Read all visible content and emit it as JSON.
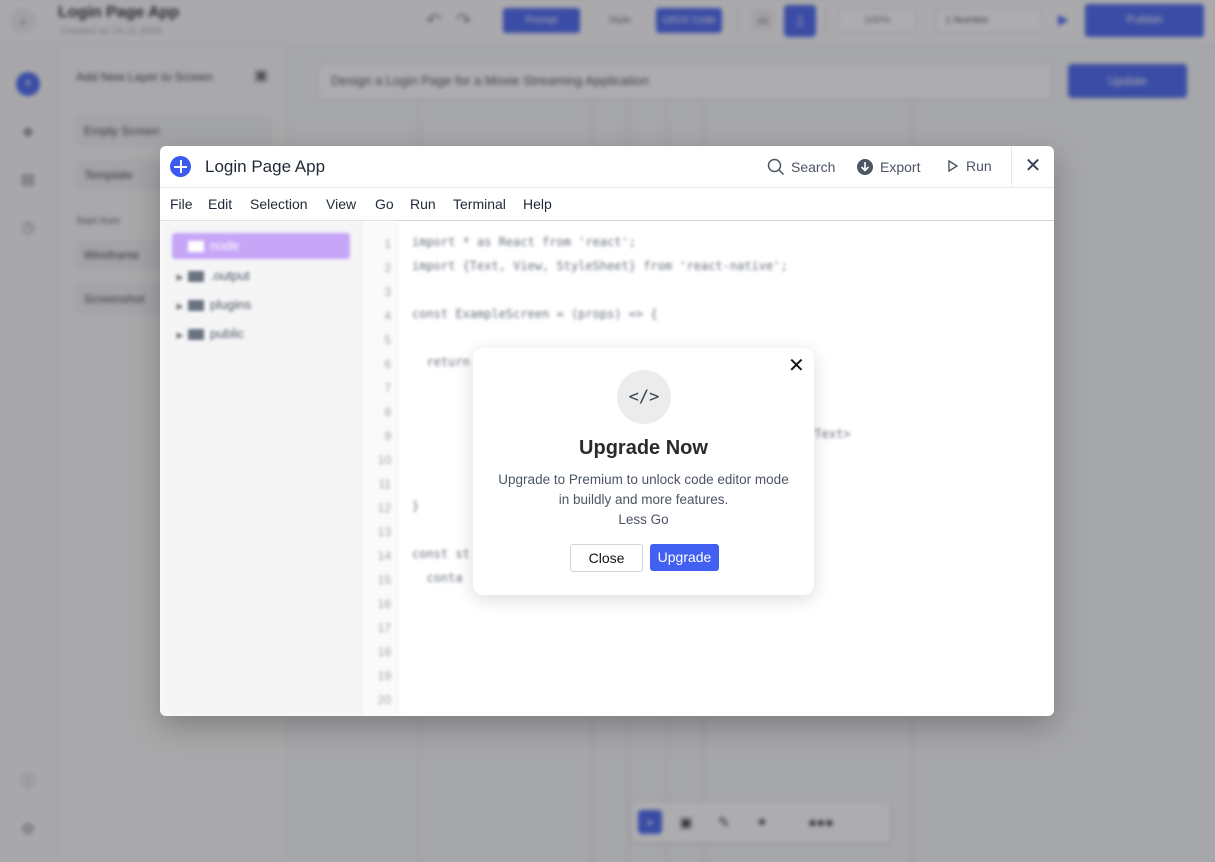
{
  "background": {
    "topbar": {
      "back_icon": "arrow-left-icon",
      "title": "Login Page App",
      "subtitle": "Created on 19.11.2024",
      "prompt_label": "Prompt",
      "style_label": "Style",
      "ui_code_label": "UI/UX Code",
      "zoom": "100%",
      "number_label": "1 Number",
      "publish_label": "Publish"
    },
    "sidepanel": {
      "header": "Add New Layer to Screen",
      "items": [
        "Empty Screen",
        "Template"
      ],
      "section": "Start from",
      "section_items": [
        "Wireframe",
        "Screenshot"
      ]
    },
    "prompt": {
      "value": "Design a Login Page for a Movie Streaming Application",
      "button": "Update"
    }
  },
  "editor": {
    "title": "Login Page App",
    "actions": {
      "search": "Search",
      "export": "Export",
      "run": "Run"
    },
    "menu": [
      "File",
      "Edit",
      "Selection",
      "View",
      "Go",
      "Run",
      "Terminal",
      "Help"
    ],
    "tree": [
      {
        "label": "node"
      },
      {
        "label": ".output"
      },
      {
        "label": "plugins"
      },
      {
        "label": "public"
      }
    ],
    "line_numbers": [
      "1",
      "2",
      "3",
      "4",
      "5",
      "6",
      "7",
      "8",
      "9",
      "10",
      "11",
      "12",
      "13",
      "14",
      "15",
      "16",
      "17",
      "18",
      "19",
      "20"
    ],
    "code": {
      "l1": "import * as React from 'react';",
      "l2": "import {Text, View, StyleSheet} from 'react-native';",
      "l4": "const ExampleScreen = (props) => {",
      "l6": "  return",
      "l9": "</Text>",
      "l12": "}",
      "l14": "const st",
      "l15": "  conta"
    }
  },
  "modal": {
    "title": "Upgrade Now",
    "icon_glyph": "</>",
    "message": "Upgrade to Premium to unlock code editor mode in buildly and more features.",
    "sub": "Less Go",
    "close_label": "Close",
    "upgrade_label": "Upgrade"
  },
  "colors": {
    "accent": "#3a59ee",
    "upgrade_button": "#4160f1",
    "selected_folder": "#c7a6f7"
  }
}
